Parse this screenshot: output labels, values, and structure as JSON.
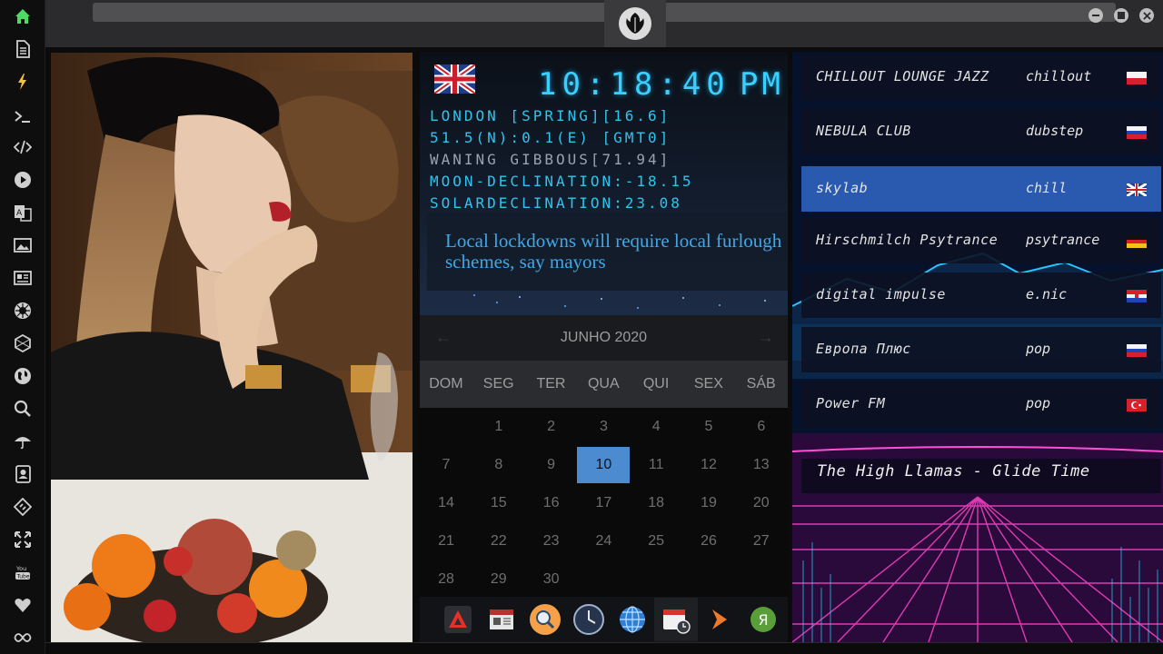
{
  "sidebar": {
    "items": [
      {
        "icon": "home-icon",
        "color": "#4cd964"
      },
      {
        "icon": "document-icon",
        "color": "#cfcfcf"
      },
      {
        "icon": "lightning-icon",
        "color": "#f0c040"
      },
      {
        "icon": "terminal-icon",
        "color": "#cfcfcf"
      },
      {
        "icon": "code-icon",
        "color": "#cfcfcf"
      },
      {
        "icon": "play-icon",
        "color": "#cfcfcf"
      },
      {
        "icon": "translate-icon",
        "color": "#cfcfcf"
      },
      {
        "icon": "image-icon",
        "color": "#cfcfcf"
      },
      {
        "icon": "news-icon",
        "color": "#cfcfcf"
      },
      {
        "icon": "rebel-icon",
        "color": "#cfcfcf"
      },
      {
        "icon": "hexagon-icon",
        "color": "#cfcfcf"
      },
      {
        "icon": "globe-icon",
        "color": "#cfcfcf"
      },
      {
        "icon": "search-icon",
        "color": "#cfcfcf"
      },
      {
        "icon": "umbrella-icon",
        "color": "#cfcfcf"
      },
      {
        "icon": "contacts-icon",
        "color": "#cfcfcf"
      },
      {
        "icon": "diamond-code-icon",
        "color": "#cfcfcf"
      },
      {
        "icon": "expand-icon",
        "color": "#cfcfcf"
      },
      {
        "icon": "youtube-icon",
        "color": "#cfcfcf",
        "label": "You Tube"
      },
      {
        "icon": "heart-icon",
        "color": "#cfcfcf"
      },
      {
        "icon": "infinity-icon",
        "color": "#cfcfcf"
      }
    ]
  },
  "topbar": {
    "logo_icon": "rebel-alliance-icon",
    "window_buttons": [
      "minimize-icon",
      "maximize-icon",
      "close-icon"
    ]
  },
  "clock": {
    "time": "10:18:40",
    "ampm": "PM",
    "flag": "uk-flag-icon",
    "lines": [
      "LONDON [SPRING][16.6]",
      "51.5(N):0.1(E) [GMT0]",
      "WANING GIBBOUS[71.94]",
      "MOON-DECLINATION:-18.15",
      "SOLARDECLINATION:23.08"
    ]
  },
  "news": {
    "headline": "Local lockdowns will require local furlough schemes, say mayors"
  },
  "calendar": {
    "month_label": "JUNHO 2020",
    "prev": "←",
    "next": "→",
    "weekdays": [
      "DOM",
      "SEG",
      "TER",
      "QUA",
      "QUI",
      "SEX",
      "SÁB"
    ],
    "weeks": [
      [
        "",
        "1",
        "2",
        "3",
        "4",
        "5",
        "6"
      ],
      [
        "7",
        "8",
        "9",
        "10",
        "11",
        "12",
        "13"
      ],
      [
        "14",
        "15",
        "16",
        "17",
        "18",
        "19",
        "20"
      ],
      [
        "21",
        "22",
        "23",
        "24",
        "25",
        "26",
        "27"
      ],
      [
        "28",
        "29",
        "30",
        "",
        "",
        "",
        ""
      ]
    ],
    "today": "10"
  },
  "dock": {
    "apps": [
      "anydesk-icon",
      "calendar-sheet-icon",
      "search-app-icon",
      "clock-app-icon",
      "globe-app-icon",
      "calendar-clock-icon",
      "arrow-app-icon",
      "yandex-icon"
    ],
    "yandex_label": "Я"
  },
  "radio": {
    "stations": [
      {
        "name": "CHILLOUT LOUNGE JAZZ",
        "genre": "chillout",
        "flag": "poland-flag-icon"
      },
      {
        "name": "NEBULA CLUB",
        "genre": "dubstep",
        "flag": "russia-flag-icon"
      },
      {
        "name": "skylab",
        "genre": "chill",
        "flag": "uk-flag-icon",
        "selected": true
      },
      {
        "name": "Hirschmilch Psytrance",
        "genre": "psytrance",
        "flag": "germany-flag-icon"
      },
      {
        "name": "digital impulse",
        "genre": "e.nic",
        "flag": "croatia-flag-icon"
      },
      {
        "name": "Европа Плюс",
        "genre": "pop",
        "flag": "russia-flag-icon"
      },
      {
        "name": "Power FM",
        "genre": "pop",
        "flag": "turkey-flag-icon"
      }
    ],
    "now_playing": "The High Llamas - Glide Time"
  },
  "colors": {
    "accent_cyan": "#39d0ff",
    "calendar_today": "#4d8bd0",
    "selected_station": "#2a5ab0"
  }
}
